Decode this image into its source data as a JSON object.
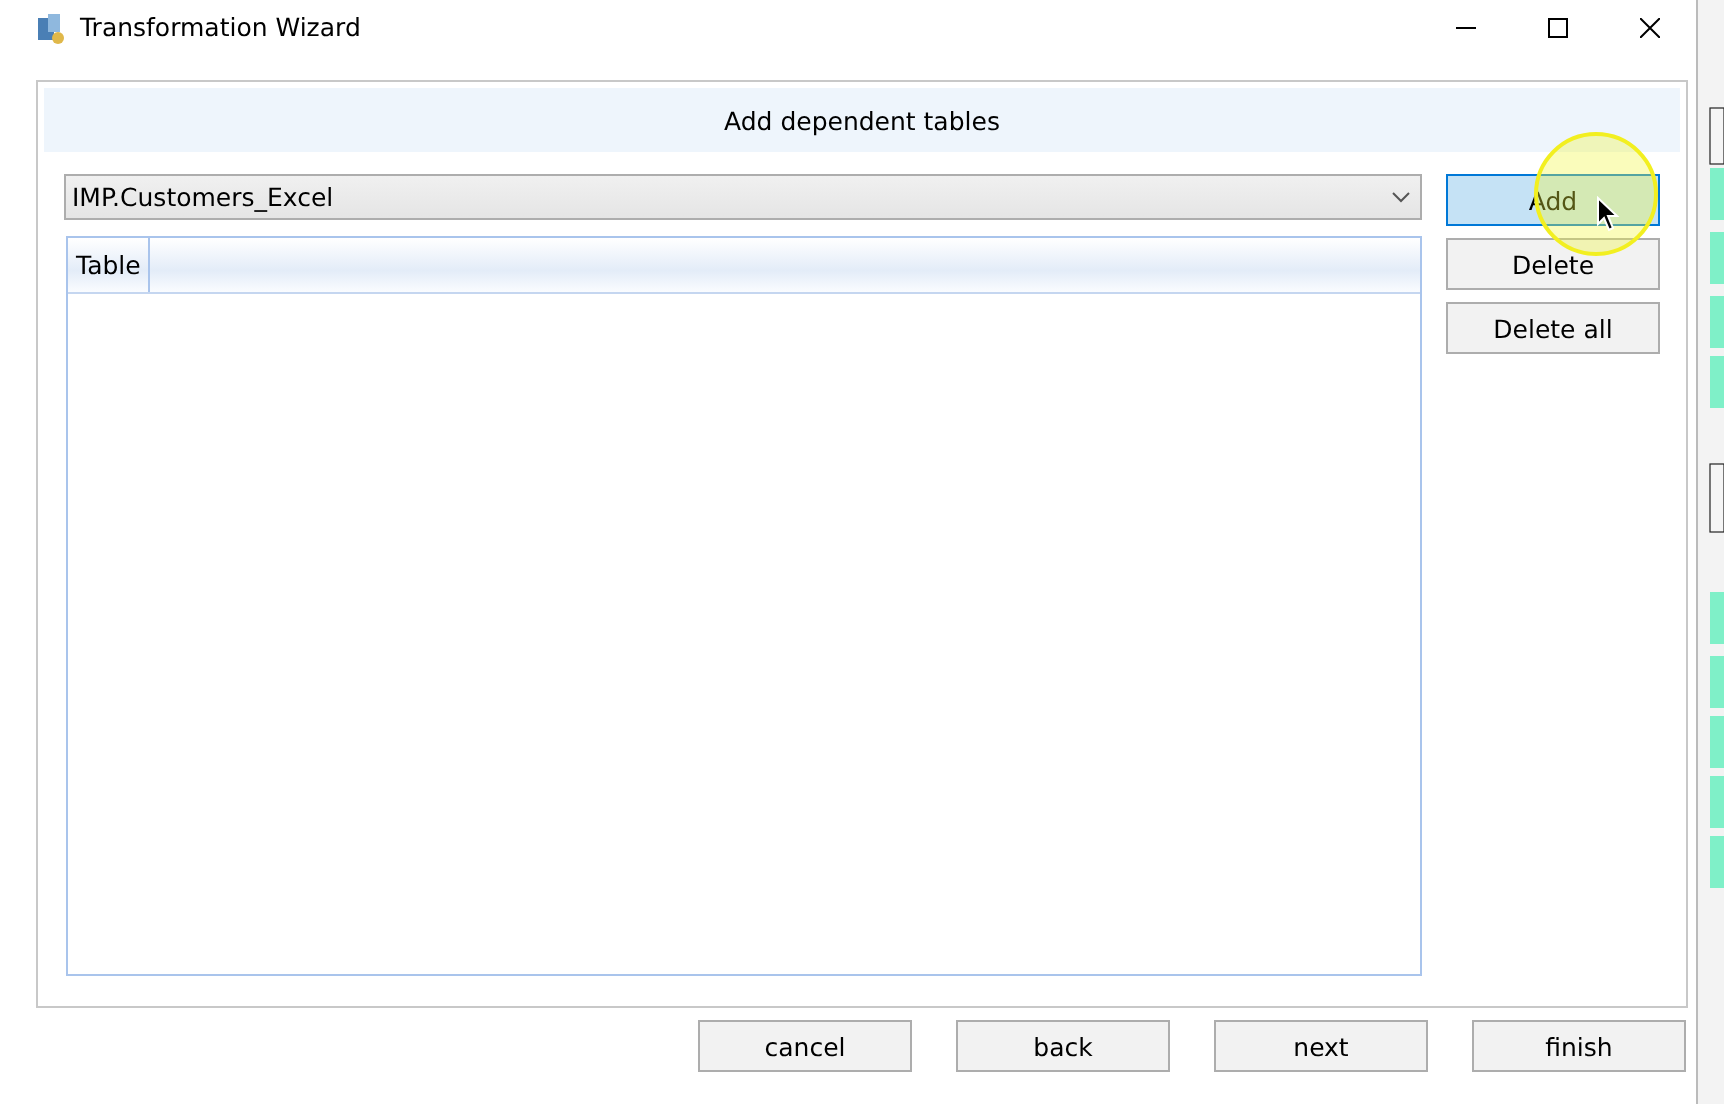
{
  "window": {
    "title": "Transformation Wizard"
  },
  "panel": {
    "title": "Add dependent tables"
  },
  "table_select": {
    "value": "IMP.Customers_Excel"
  },
  "table": {
    "columns": [
      "Table"
    ]
  },
  "side_buttons": [
    {
      "label": "Add",
      "hovered": true
    },
    {
      "label": "Delete",
      "hovered": false
    },
    {
      "label": "Delete all",
      "hovered": false
    }
  ],
  "footer_buttons": [
    "cancel",
    "back",
    "next",
    "finish"
  ]
}
